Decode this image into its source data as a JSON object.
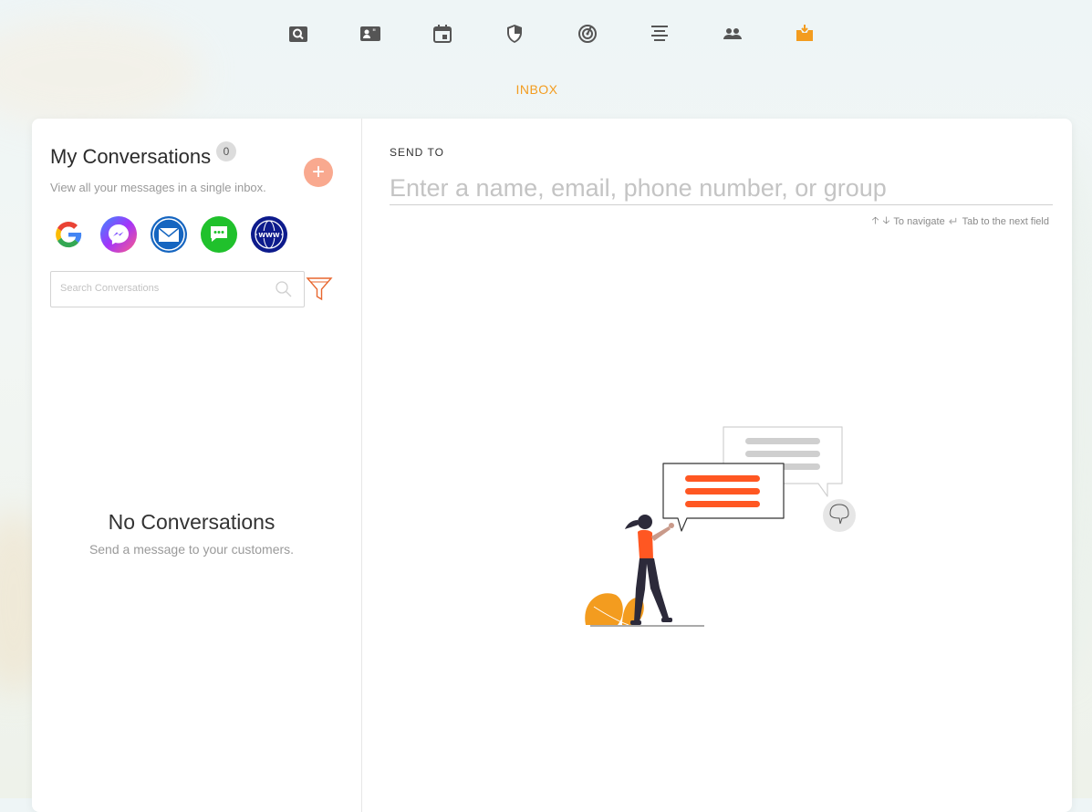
{
  "nav": {
    "active_label": "INBOX",
    "active_color": "#f39c1f",
    "icon_color": "#555555",
    "items": [
      "search-icon",
      "contact-card-icon",
      "calendar-icon",
      "shield-icon",
      "radar-icon",
      "align-center-icon",
      "people-icon",
      "inbox-icon"
    ]
  },
  "conversations": {
    "title": "My Conversations",
    "count": "0",
    "subtitle": "View all your messages in a single inbox.",
    "add_label": "+",
    "channels": [
      "google-icon",
      "messenger-icon",
      "email-icon",
      "sms-icon",
      "web-icon"
    ],
    "search_placeholder": "Search Conversations",
    "empty_title": "No Conversations",
    "empty_subtitle": "Send a message to your customers."
  },
  "compose": {
    "send_to_label": "SEND TO",
    "to_placeholder": "Enter a name, email, phone number, or group",
    "hint_navigate": "To navigate",
    "hint_tab": "Tab to the next field"
  },
  "colors": {
    "accent": "#f39c1f",
    "add_button": "#f9a98f",
    "illustration_orange": "#ff5722"
  }
}
